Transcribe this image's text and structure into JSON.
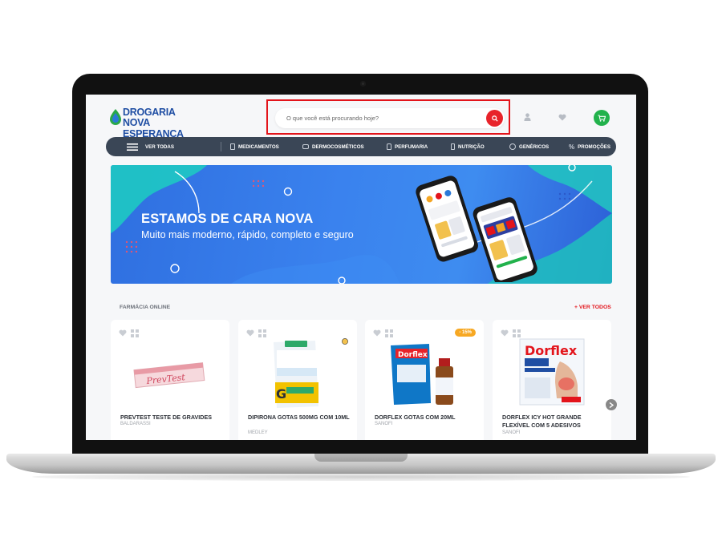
{
  "header": {
    "logo_line1": "DROGARIA",
    "logo_line2": "NOVA ESPERANÇA",
    "search_placeholder": "O que você está procurando hoje?"
  },
  "nav": {
    "items": [
      {
        "label": "VER TODAS",
        "icon": "menu-icon"
      },
      {
        "label": "MEDICAMENTOS",
        "icon": "medicine-icon"
      },
      {
        "label": "DERMOCOSMÉTICOS",
        "icon": "cosmetics-icon"
      },
      {
        "label": "PERFUMARIA",
        "icon": "perfume-icon"
      },
      {
        "label": "NUTRIÇÃO",
        "icon": "nutrition-icon"
      },
      {
        "label": "GENÉRICOS",
        "icon": "generic-icon"
      },
      {
        "label": "PROMOÇÕES",
        "icon": "percent-icon"
      }
    ]
  },
  "banner": {
    "title": "ESTAMOS DE CARA NOVA",
    "subtitle": "Muito mais moderno, rápido, completo e seguro"
  },
  "section": {
    "title": "FARMÁCIA ONLINE",
    "see_all": "+ VER TODOS"
  },
  "products": [
    {
      "name": "PREVTEST TESTE DE GRAVIDES",
      "brand": "BALDARASSI",
      "discount": ""
    },
    {
      "name": "DIPIRONA GOTAS 500MG COM 10ML",
      "brand": "MEDLEY",
      "discount": ""
    },
    {
      "name": "DORFLEX GOTAS COM 20ML",
      "brand": "SANOFI",
      "discount": "- 15%"
    },
    {
      "name": "DORFLEX ICY HOT GRANDE FLEXÍVEL COM 5 ADESIVOS",
      "brand": "SANOFI",
      "discount": ""
    }
  ],
  "colors": {
    "brand_blue": "#1f4ea3",
    "accent_red": "#e3141b",
    "cart_green": "#22b24c",
    "nav_dark": "#3a4656",
    "banner_blue": "#3a82ee",
    "discount_orange": "#f7a823"
  }
}
